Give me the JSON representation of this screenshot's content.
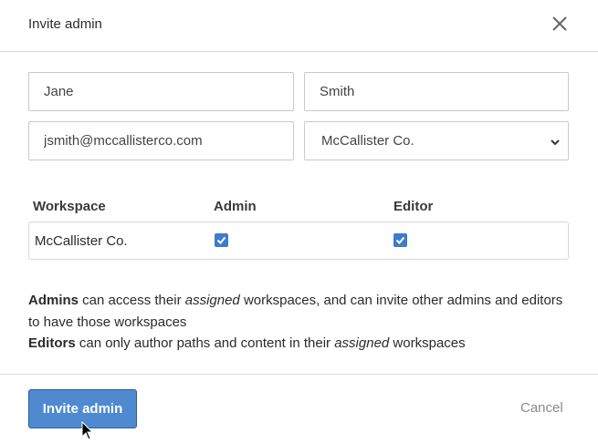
{
  "dialog": {
    "title": "Invite admin"
  },
  "form": {
    "first_name": "Jane",
    "last_name": "Smith",
    "email": "jsmith@mccallisterco.com",
    "organization_selected": "McCallister Co."
  },
  "permissions": {
    "headers": [
      "Workspace",
      "Admin",
      "Editor"
    ],
    "rows": [
      {
        "workspace": "McCallister Co.",
        "admin": true,
        "editor": true
      }
    ]
  },
  "description": {
    "admins_label": "Admins",
    "admins_text_1": " can access their ",
    "assigned": "assigned",
    "admins_text_2": " workspaces, and can invite other admins and editors",
    "admins_text_3": "to have those workspaces",
    "editors_label": "Editors",
    "editors_text_1": " can only author paths and content in their ",
    "editors_text_2": " workspaces"
  },
  "footer": {
    "submit_label": "Invite admin",
    "cancel_label": "Cancel"
  },
  "colors": {
    "primary": "#4f8ad0",
    "checkbox": "#3d7cc9",
    "cancel": "#8a8a8a"
  },
  "icons": {
    "close": "close-icon",
    "select_caret": "chevron-down-icon",
    "check": "checkmark-icon",
    "cursor": "mouse-pointer-icon"
  }
}
